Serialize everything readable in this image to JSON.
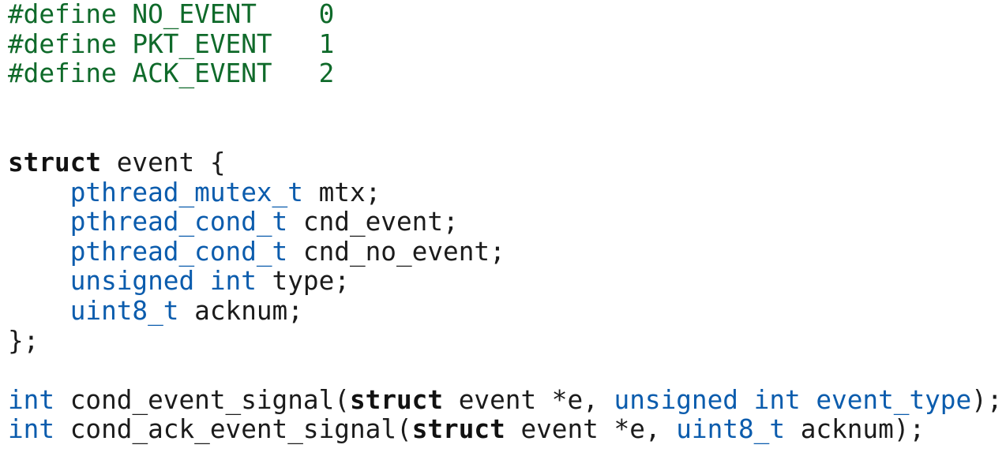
{
  "code_block": {
    "lines": [
      [
        {
          "t": "pp",
          "v": "#define NO_EVENT    0"
        }
      ],
      [
        {
          "t": "pp",
          "v": "#define PKT_EVENT   1"
        }
      ],
      [
        {
          "t": "pp",
          "v": "#define ACK_EVENT   2"
        }
      ],
      [],
      [],
      [
        {
          "t": "kw",
          "v": "struct"
        },
        {
          "t": "tx",
          "v": " event {"
        }
      ],
      [
        {
          "t": "tx",
          "v": "    "
        },
        {
          "t": "ty",
          "v": "pthread_mutex_t"
        },
        {
          "t": "tx",
          "v": " mtx;"
        }
      ],
      [
        {
          "t": "tx",
          "v": "    "
        },
        {
          "t": "ty",
          "v": "pthread_cond_t"
        },
        {
          "t": "tx",
          "v": " cnd_event;"
        }
      ],
      [
        {
          "t": "tx",
          "v": "    "
        },
        {
          "t": "ty",
          "v": "pthread_cond_t"
        },
        {
          "t": "tx",
          "v": " cnd_no_event;"
        }
      ],
      [
        {
          "t": "tx",
          "v": "    "
        },
        {
          "t": "ty",
          "v": "unsigned int"
        },
        {
          "t": "tx",
          "v": " type;"
        }
      ],
      [
        {
          "t": "tx",
          "v": "    "
        },
        {
          "t": "ty",
          "v": "uint8_t"
        },
        {
          "t": "tx",
          "v": " acknum;"
        }
      ],
      [
        {
          "t": "tx",
          "v": "};"
        }
      ],
      [],
      [
        {
          "t": "ty",
          "v": "int"
        },
        {
          "t": "tx",
          "v": " cond_event_signal("
        },
        {
          "t": "kw",
          "v": "struct"
        },
        {
          "t": "tx",
          "v": " event *e, "
        },
        {
          "t": "ty",
          "v": "unsigned int event_type"
        },
        {
          "t": "tx",
          "v": ");"
        }
      ],
      [
        {
          "t": "ty",
          "v": "int"
        },
        {
          "t": "tx",
          "v": " cond_ack_event_signal("
        },
        {
          "t": "kw",
          "v": "struct"
        },
        {
          "t": "tx",
          "v": " event *e, "
        },
        {
          "t": "ty",
          "v": "uint8_t"
        },
        {
          "t": "tx",
          "v": " acknum);"
        }
      ]
    ]
  },
  "colors": {
    "background": "#ffffff",
    "preprocessor": "#0f6a2a",
    "type": "#0b5cad",
    "keyword": "#111111",
    "text": "#1b1b1b"
  }
}
